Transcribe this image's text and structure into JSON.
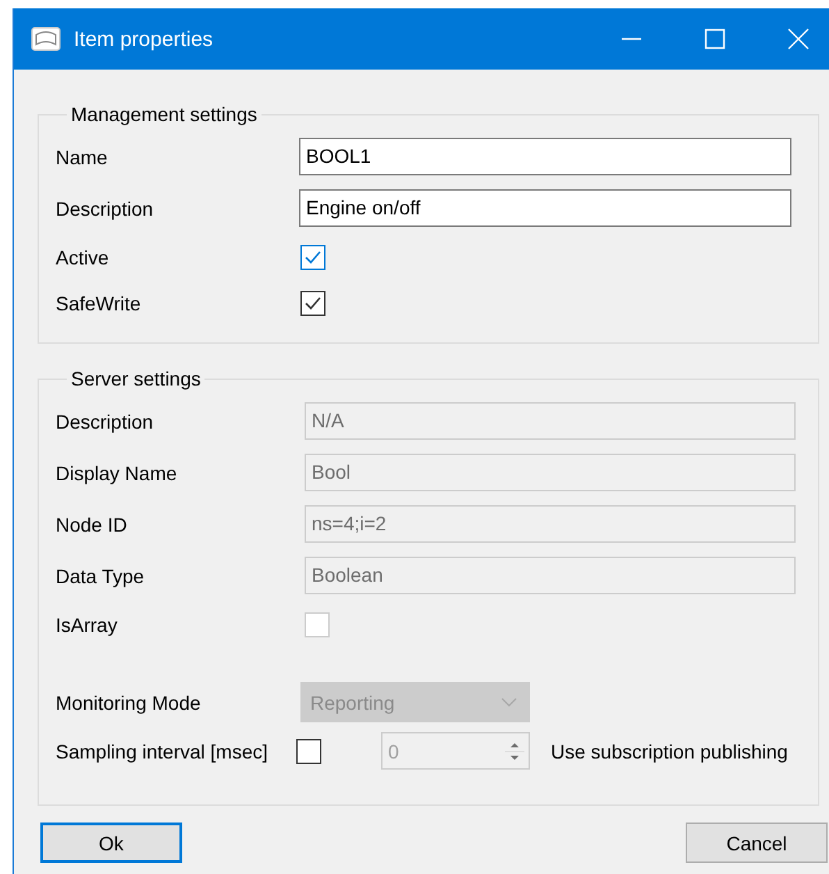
{
  "window": {
    "title": "Item properties"
  },
  "management_settings": {
    "title": "Management settings",
    "rows": [
      {
        "kind": "text",
        "label": "Name",
        "value": "BOOL1",
        "disabled": false
      },
      {
        "kind": "text",
        "label": "Description",
        "value": "Engine on/off",
        "disabled": false
      },
      {
        "kind": "checkbox",
        "label": "Active",
        "checked": true,
        "focused": true,
        "disabled": false
      },
      {
        "kind": "checkbox",
        "label": "SafeWrite",
        "checked": true,
        "disabled": false
      }
    ]
  },
  "server_settings": {
    "title": "Server settings",
    "rows": [
      {
        "kind": "text",
        "label": "Description",
        "value": "N/A",
        "disabled": true
      },
      {
        "kind": "text",
        "label": "Display Name",
        "value": "Bool",
        "disabled": true
      },
      {
        "kind": "text",
        "label": "Node ID",
        "value": "ns=4;i=2",
        "disabled": true
      },
      {
        "kind": "text",
        "label": "Data Type",
        "value": "Boolean",
        "disabled": true
      },
      {
        "kind": "checkbox",
        "label": "IsArray",
        "checked": false,
        "disabled": true
      }
    ],
    "monitoring_mode": {
      "label": "Monitoring Mode",
      "value": "Reporting",
      "disabled": true
    },
    "sampling_interval": {
      "label": "Sampling interval [msec]",
      "checked": false,
      "value": "0",
      "disabled": true,
      "note": "Use subscription publishing"
    }
  },
  "buttons": [
    {
      "label": "Ok",
      "focused": true
    },
    {
      "label": "Cancel",
      "focused": false
    }
  ]
}
